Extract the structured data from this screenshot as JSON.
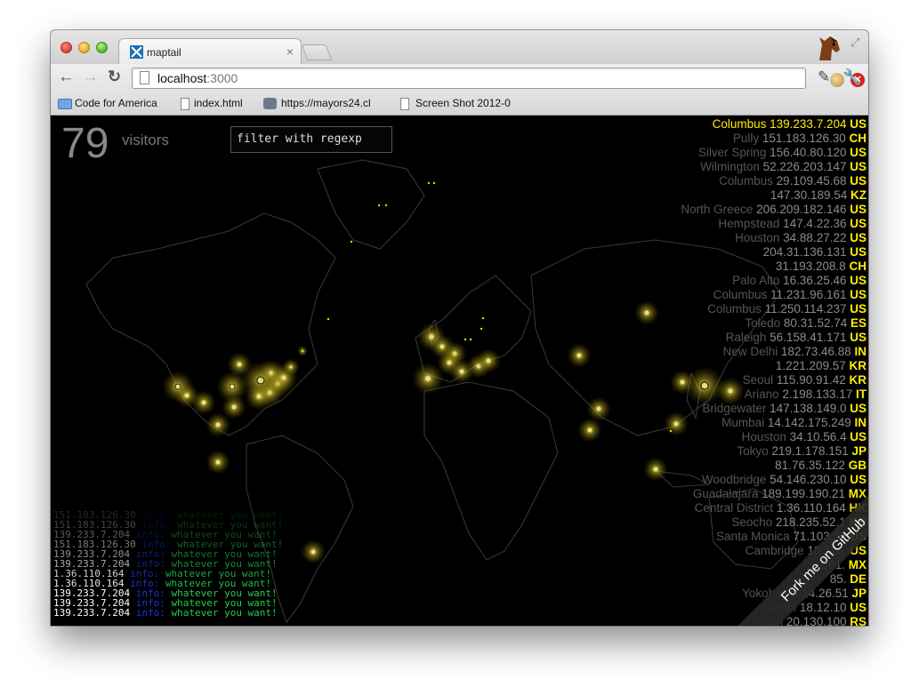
{
  "browser": {
    "tab_title": "maptail",
    "tab_close": "×",
    "url_host": "localhost",
    "url_port": ":3000"
  },
  "bookmarks": [
    {
      "label": "Code for America"
    },
    {
      "label": "index.html"
    },
    {
      "label": "https://mayors24.cl"
    },
    {
      "label": "Screen Shot 2012-0"
    }
  ],
  "page": {
    "visitor_count": "79",
    "visitor_label": "visitors",
    "filter_placeholder": "filter with regexp",
    "fork_ribbon": "Fork me on GitHub"
  },
  "visitors": [
    {
      "city": "Columbus",
      "ip": "139.233.7.204",
      "cc": "US"
    },
    {
      "city": "Pully",
      "ip": "151.183.126.30",
      "cc": "CH"
    },
    {
      "city": "Silver Spring",
      "ip": "156.40.80.120",
      "cc": "US"
    },
    {
      "city": "Wilmington",
      "ip": "52.226.203.147",
      "cc": "US"
    },
    {
      "city": "Columbus",
      "ip": "29.109.45.68",
      "cc": "US"
    },
    {
      "city": "",
      "ip": "147.30.189.54",
      "cc": "KZ"
    },
    {
      "city": "North Greece",
      "ip": "206.209.182.146",
      "cc": "US"
    },
    {
      "city": "Hempstead",
      "ip": "147.4.22.36",
      "cc": "US"
    },
    {
      "city": "Houston",
      "ip": "34.88.27.22",
      "cc": "US"
    },
    {
      "city": "",
      "ip": "204.31.136.131",
      "cc": "US"
    },
    {
      "city": "",
      "ip": "31.193.208.8",
      "cc": "CH"
    },
    {
      "city": "Palo Alto",
      "ip": "16.36.25.46",
      "cc": "US"
    },
    {
      "city": "Columbus",
      "ip": "11.231.96.161",
      "cc": "US"
    },
    {
      "city": "Columbus",
      "ip": "11.250.114.237",
      "cc": "US"
    },
    {
      "city": "Toledo",
      "ip": "80.31.52.74",
      "cc": "ES"
    },
    {
      "city": "Raleigh",
      "ip": "56.158.41.171",
      "cc": "US"
    },
    {
      "city": "New Delhi",
      "ip": "182.73.46.88",
      "cc": "IN"
    },
    {
      "city": "",
      "ip": "1.221.209.57",
      "cc": "KR"
    },
    {
      "city": "Seoul",
      "ip": "115.90.91.42",
      "cc": "KR"
    },
    {
      "city": "Ariano",
      "ip": "2.198.133.17",
      "cc": "IT"
    },
    {
      "city": "Bridgewater",
      "ip": "147.138.149.0",
      "cc": "US"
    },
    {
      "city": "Mumbai",
      "ip": "14.142.175.249",
      "cc": "IN"
    },
    {
      "city": "Houston",
      "ip": "34.10.56.4",
      "cc": "US"
    },
    {
      "city": "Tokyo",
      "ip": "219.1.178.151",
      "cc": "JP"
    },
    {
      "city": "",
      "ip": "81.76.35.122",
      "cc": "GB"
    },
    {
      "city": "Woodbridge",
      "ip": "54.146.230.10",
      "cc": "US"
    },
    {
      "city": "Guadalajara",
      "ip": "189.199.190.21",
      "cc": "MX"
    },
    {
      "city": "Central District",
      "ip": "1.36.110.164",
      "cc": "HK"
    },
    {
      "city": "Seocho",
      "ip": "218.235.52.1",
      "cc": "KR"
    },
    {
      "city": "Santa Monica",
      "ip": "71.103.25",
      "cc": "US"
    },
    {
      "city": "Cambridge",
      "ip": "18.116.",
      "cc": "US"
    },
    {
      "city": "",
      "ip": "201.",
      "cc": "MX"
    },
    {
      "city": "",
      "ip": "85.",
      "cc": "DE"
    },
    {
      "city": "Yokohama",
      "ip": "14.26.51",
      "cc": "JP"
    },
    {
      "city": "Washi",
      "ip": "18.12.10",
      "cc": "US"
    },
    {
      "city": "Rali",
      "ip": "20.130.100",
      "cc": "RS"
    }
  ],
  "log": [
    {
      "ip": "151.183.126.30",
      "lvl": "info:",
      "msg": "whatever you want!",
      "o": 0.15
    },
    {
      "ip": "151.183.126.30",
      "lvl": "info:",
      "msg": "whatever you want!",
      "o": 0.25
    },
    {
      "ip": "139.233.7.204",
      "lvl": "info:",
      "msg": "whatever you want!",
      "o": 0.35
    },
    {
      "ip": "151.183.126.30",
      "lvl": "info:",
      "msg": "whatever you want!",
      "o": 0.45
    },
    {
      "ip": "139.233.7.204",
      "lvl": "info:",
      "msg": "whatever you want!",
      "o": 0.55
    },
    {
      "ip": "139.233.7.204",
      "lvl": "info:",
      "msg": "whatever you want!",
      "o": 0.65
    },
    {
      "ip": "1.36.110.164",
      "lvl": "info:",
      "msg": "whatever you want!",
      "o": 0.8
    },
    {
      "ip": "1.36.110.164",
      "lvl": "info:",
      "msg": "whatever you want!",
      "o": 0.9
    },
    {
      "ip": "139.233.7.204",
      "lvl": "info:",
      "msg": "whatever you want!",
      "o": 1
    },
    {
      "ip": "139.233.7.204",
      "lvl": "info:",
      "msg": "whatever you want!",
      "o": 1
    },
    {
      "ip": "139.233.7.204",
      "lvl": "info:",
      "msg": "whatever you want!",
      "o": 1
    }
  ]
}
